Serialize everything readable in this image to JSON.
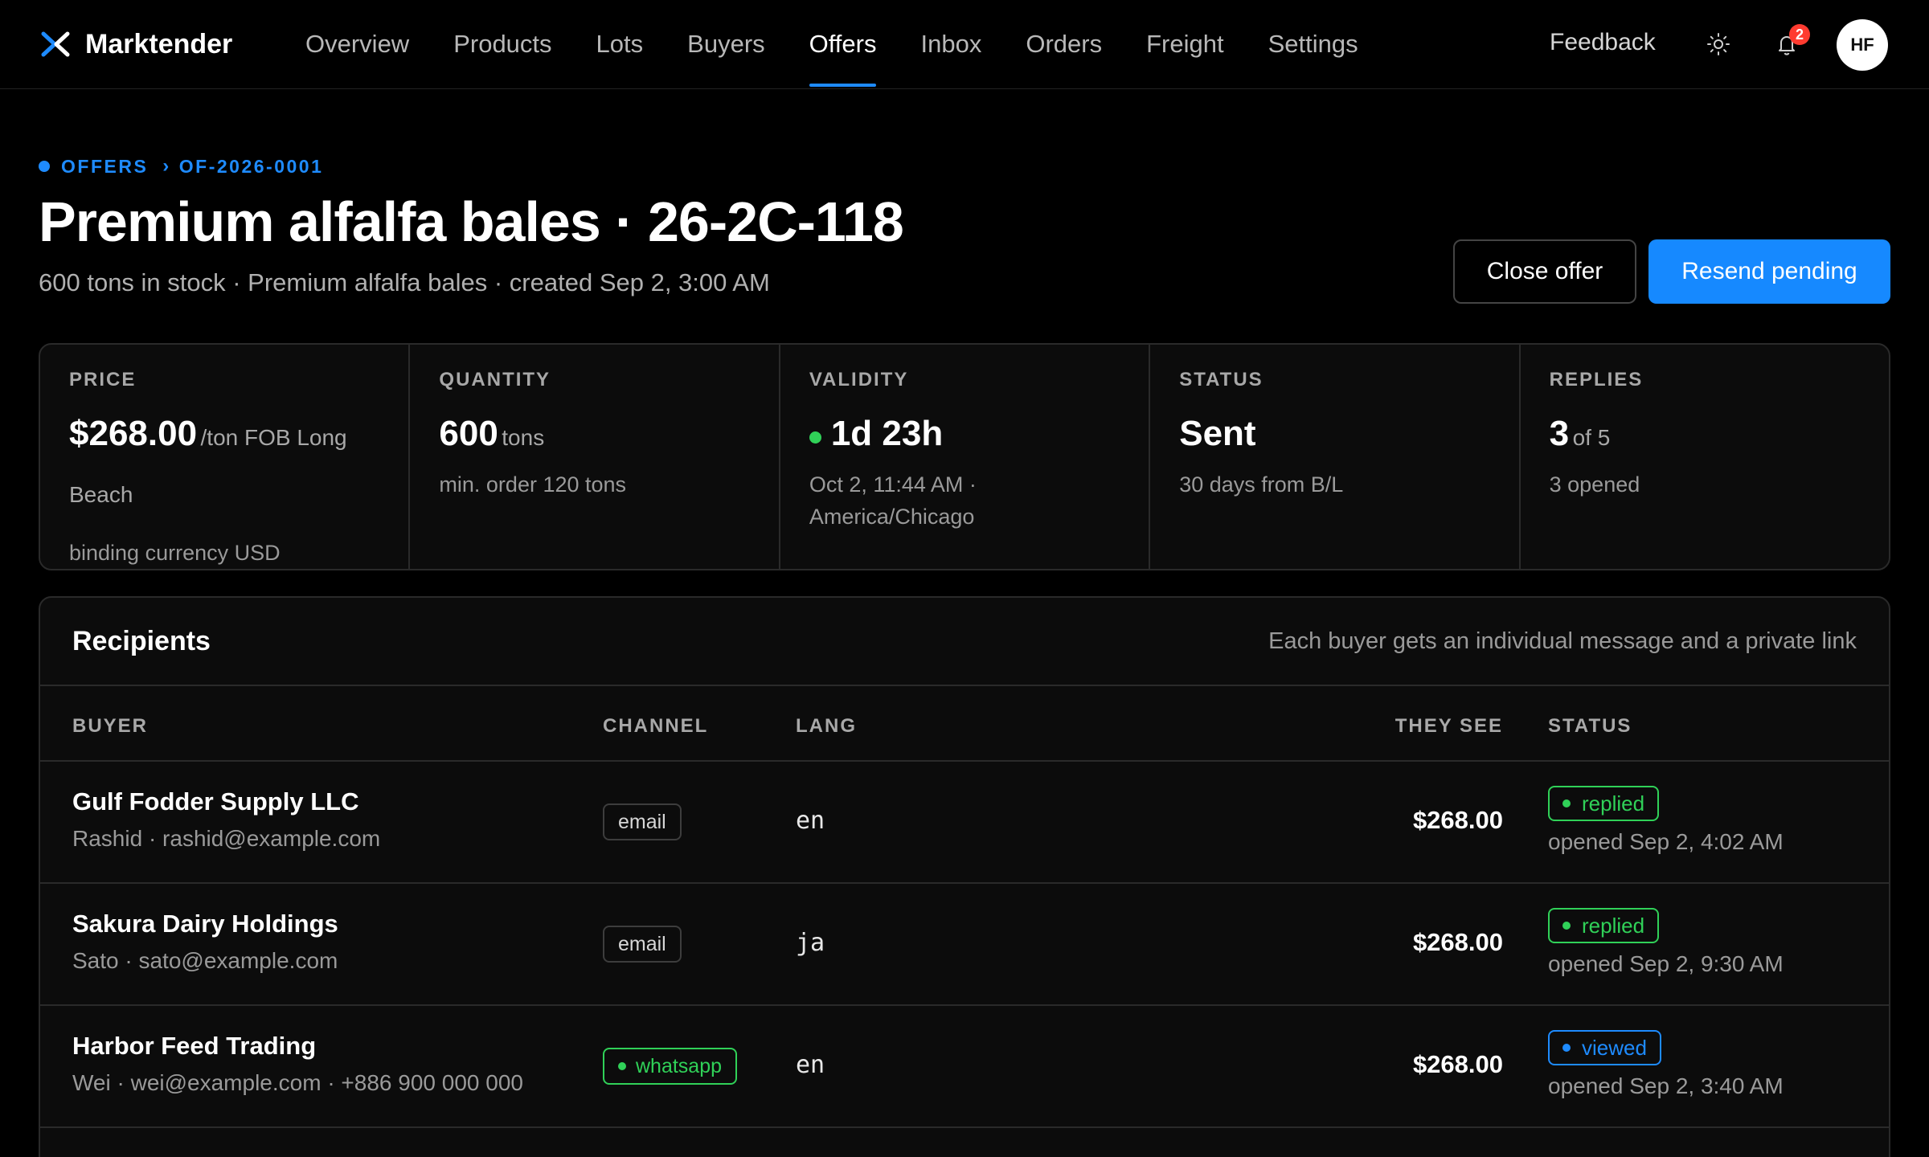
{
  "app": {
    "name": "Marktender"
  },
  "nav": {
    "items": [
      "Overview",
      "Products",
      "Lots",
      "Buyers",
      "Offers",
      "Inbox",
      "Orders",
      "Freight",
      "Settings"
    ],
    "active": "Offers"
  },
  "header_right": {
    "feedback": "Feedback",
    "notifications_count": "2",
    "avatar_initials": "HF"
  },
  "breadcrumb": {
    "section": "OFFERS",
    "current": "OF-2026-0001"
  },
  "offer": {
    "title": "Premium alfalfa bales · 26-2C-118",
    "subtitle": "600 tons in stock · Premium alfalfa bales · created Sep 2, 3:00 AM"
  },
  "actions": {
    "close": "Close offer",
    "resend": "Resend pending"
  },
  "stats": {
    "price": {
      "label": "PRICE",
      "value": "$268.00",
      "unit": "/ton FOB Long Beach",
      "sub": "binding currency USD"
    },
    "quantity": {
      "label": "QUANTITY",
      "value": "600",
      "unit": "tons",
      "sub": "min. order 120 tons"
    },
    "validity": {
      "label": "VALIDITY",
      "value": "1d 23h",
      "sub": "Oct 2, 11:44 AM · America/Chicago"
    },
    "status": {
      "label": "STATUS",
      "value": "Sent",
      "sub": "30 days from B/L"
    },
    "replies": {
      "label": "REPLIES",
      "value": "3",
      "unit": "of 5",
      "sub": "3 opened"
    }
  },
  "recipients": {
    "title": "Recipients",
    "note": "Each buyer gets an individual message and a private link",
    "columns": {
      "buyer": "BUYER",
      "channel": "CHANNEL",
      "lang": "LANG",
      "they_see": "THEY SEE",
      "status": "STATUS"
    },
    "rows": [
      {
        "name": "Gulf Fodder Supply LLC",
        "contact": "Rashid · rashid@example.com",
        "channel": "email",
        "lang": "en",
        "price": "$268.00",
        "status": "replied",
        "opened": "opened Sep 2, 4:02 AM"
      },
      {
        "name": "Sakura Dairy Holdings",
        "contact": "Sato · sato@example.com",
        "channel": "email",
        "lang": "ja",
        "price": "$268.00",
        "status": "replied",
        "opened": "opened Sep 2, 9:30 AM"
      },
      {
        "name": "Harbor Feed Trading",
        "contact": "Wei · wei@example.com · +886 900 000 000",
        "channel": "whatsapp",
        "lang": "en",
        "price": "$268.00",
        "status": "viewed",
        "opened": "opened Sep 2, 3:40 AM"
      }
    ]
  },
  "colors": {
    "accent": "#1e8bff",
    "success": "#30d158",
    "primary_button": "#1689ff",
    "badge": "#ff3b30"
  }
}
